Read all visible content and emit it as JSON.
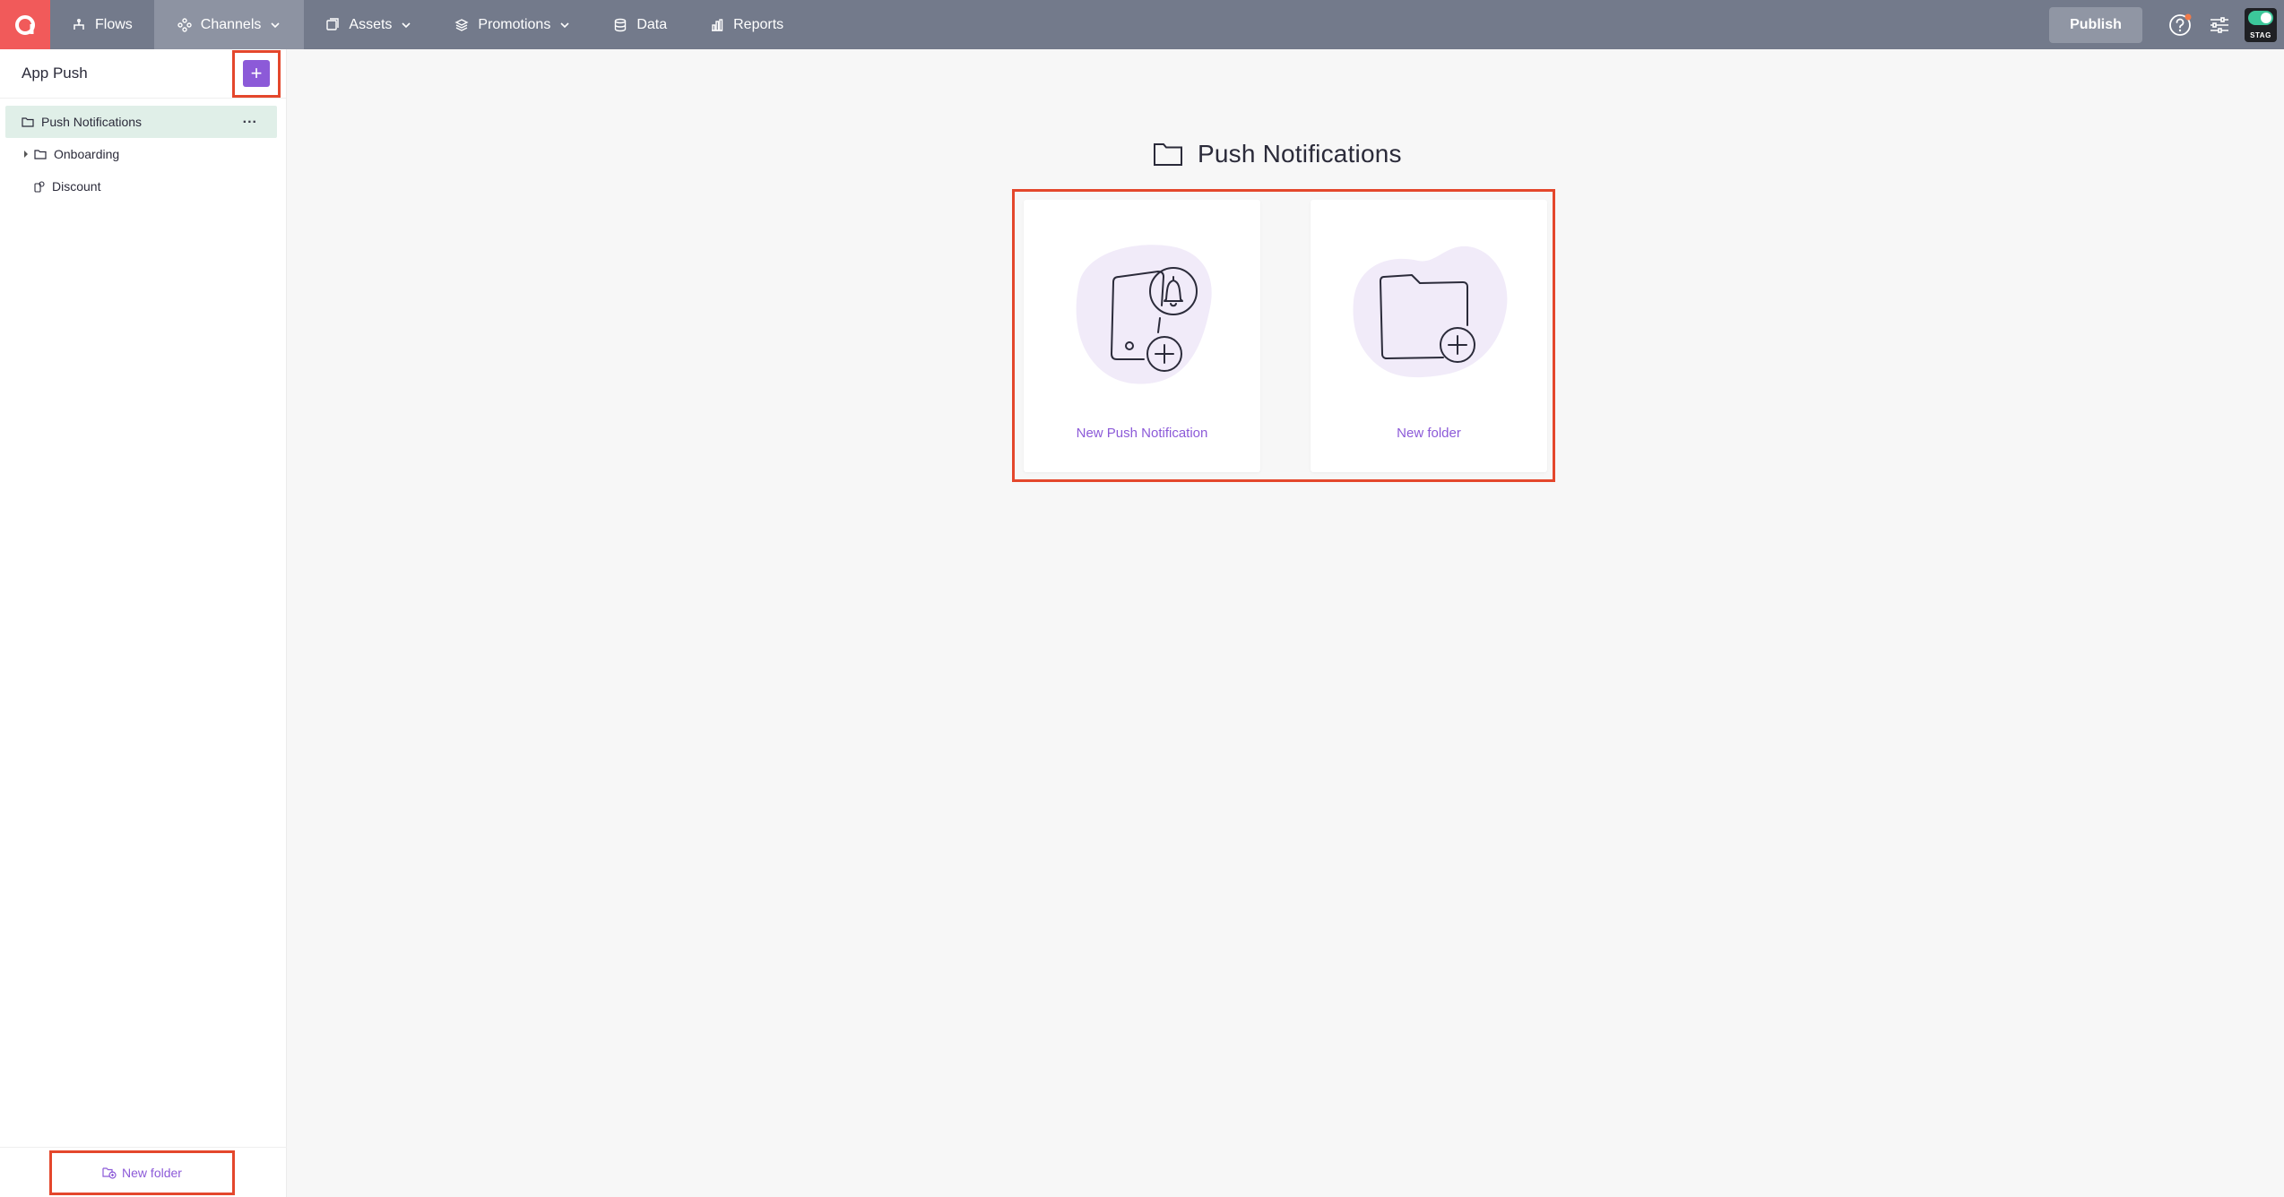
{
  "app": {
    "logo_letter": "a"
  },
  "nav": {
    "items": [
      {
        "id": "flows",
        "label": "Flows",
        "icon": "flows-icon",
        "has_caret": false,
        "active": false
      },
      {
        "id": "channels",
        "label": "Channels",
        "icon": "channels-icon",
        "has_caret": true,
        "active": true
      },
      {
        "id": "assets",
        "label": "Assets",
        "icon": "assets-icon",
        "has_caret": true,
        "active": false
      },
      {
        "id": "promotions",
        "label": "Promotions",
        "icon": "promotions-icon",
        "has_caret": true,
        "active": false
      },
      {
        "id": "data",
        "label": "Data",
        "icon": "database-icon",
        "has_caret": false,
        "active": false
      },
      {
        "id": "reports",
        "label": "Reports",
        "icon": "bar-chart-icon",
        "has_caret": false,
        "active": false
      }
    ],
    "publish_label": "Publish",
    "environment_label": "STAG"
  },
  "sidebar": {
    "title": "App Push",
    "add_label": "+",
    "items": [
      {
        "label": "Push Notifications",
        "type": "folder",
        "selected": true,
        "expandable": false
      },
      {
        "label": "Onboarding",
        "type": "folder",
        "selected": false,
        "expandable": true
      },
      {
        "label": "Discount",
        "type": "notification",
        "selected": false,
        "expandable": false
      }
    ],
    "more_label": "...",
    "footer_new_folder": "New folder"
  },
  "main": {
    "title": "Push Notifications",
    "cards": [
      {
        "label": "New Push Notification",
        "icon": "new-push-notification-illustration"
      },
      {
        "label": "New folder",
        "icon": "new-folder-illustration"
      }
    ]
  },
  "colors": {
    "topbar": "#737a8b",
    "logo": "#f15a5a",
    "accent": "#8c5ad8",
    "highlight_box": "#e4472c",
    "selected_row": "#e0efe8",
    "illustration_blob": "#f1ebf9"
  }
}
